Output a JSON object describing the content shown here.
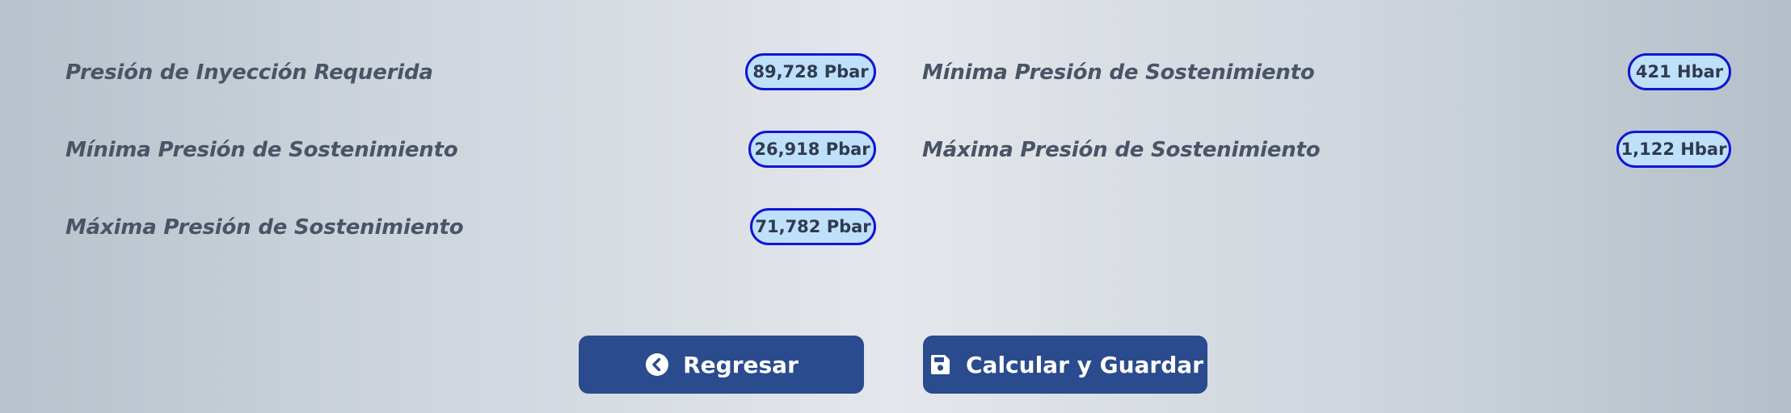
{
  "left_column": [
    {
      "label": "Presión de Inyección Requerida",
      "value": "89,728 Pbar"
    },
    {
      "label": "Mínima Presión de Sostenimiento",
      "value": "26,918 Pbar"
    },
    {
      "label": "Máxima Presión de Sostenimiento",
      "value": "71,782 Pbar"
    }
  ],
  "right_column": [
    {
      "label": "Mínima Presión de Sostenimiento",
      "value": "421 Hbar"
    },
    {
      "label": "Máxima Presión de Sostenimiento",
      "value": "1,122 Hbar"
    }
  ],
  "buttons": {
    "back_label": "Regresar",
    "back_icon": "chevron-left-circle-icon",
    "save_label": "Calcular y Guardar",
    "save_icon": "floppy-disk-icon"
  },
  "colors": {
    "button_bg": "#2a4b8e",
    "badge_border": "#1015d4",
    "badge_bg": "#bfe0fb",
    "label_text": "#4a5466"
  }
}
